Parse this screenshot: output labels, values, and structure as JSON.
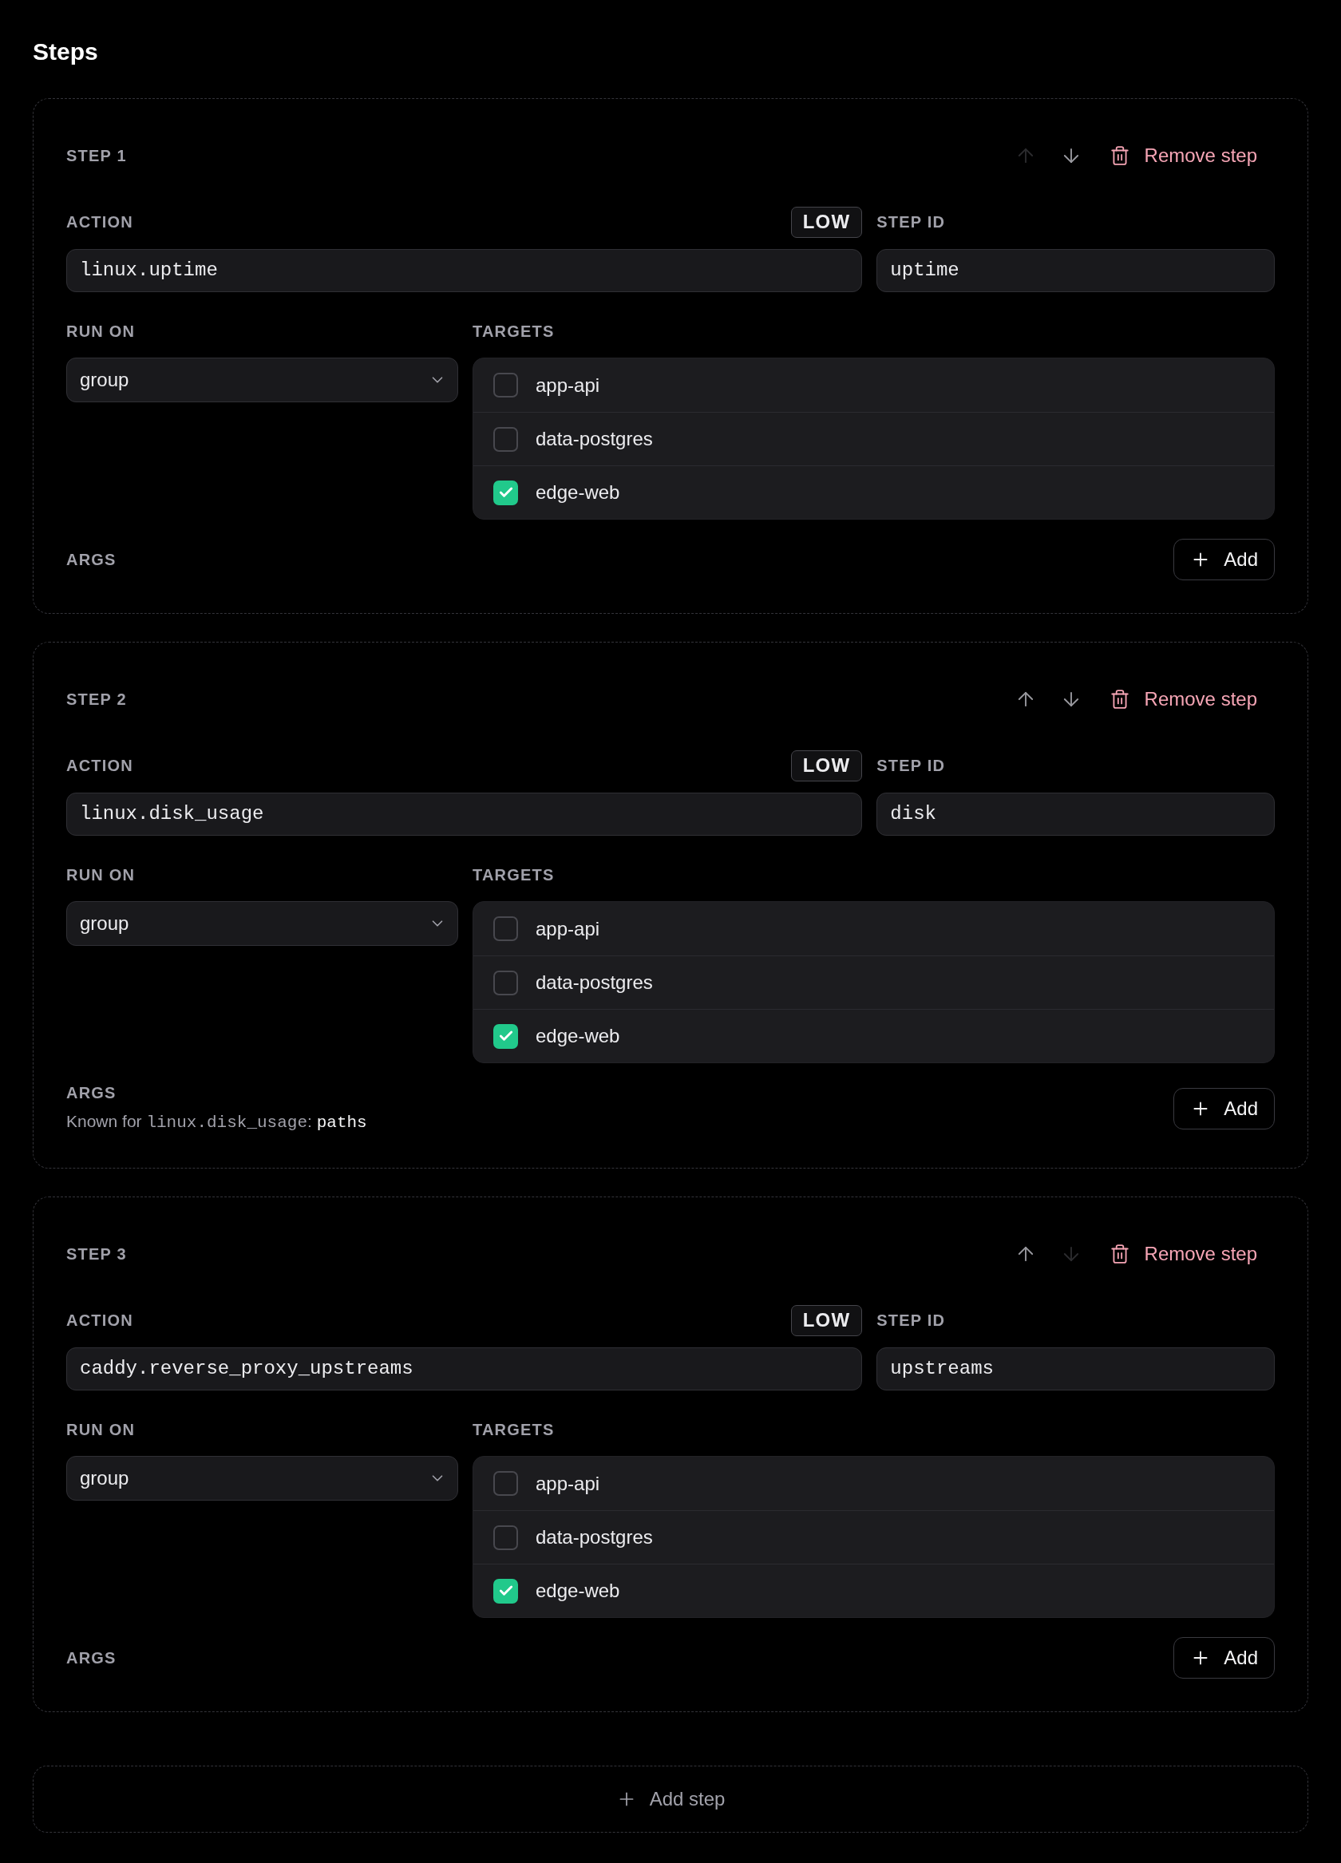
{
  "title": "Steps",
  "steps": [
    {
      "label": "STEP 1",
      "move_up": {
        "disabled": true
      },
      "move_down": {
        "disabled": false
      },
      "remove_label": "Remove step",
      "action": {
        "label": "ACTION",
        "value": "linux.uptime",
        "risk": "LOW"
      },
      "step_id": {
        "label": "STEP ID",
        "value": "uptime"
      },
      "run_on": {
        "label": "RUN ON",
        "value": "group"
      },
      "targets": {
        "label": "TARGETS",
        "items": [
          {
            "name": "app-api",
            "checked": false
          },
          {
            "name": "data-postgres",
            "checked": false
          },
          {
            "name": "edge-web",
            "checked": true
          }
        ]
      },
      "args": {
        "label": "ARGS",
        "add_label": "Add"
      }
    },
    {
      "label": "STEP 2",
      "move_up": {
        "disabled": false
      },
      "move_down": {
        "disabled": false
      },
      "remove_label": "Remove step",
      "action": {
        "label": "ACTION",
        "value": "linux.disk_usage",
        "risk": "LOW"
      },
      "step_id": {
        "label": "STEP ID",
        "value": "disk"
      },
      "run_on": {
        "label": "RUN ON",
        "value": "group"
      },
      "targets": {
        "label": "TARGETS",
        "items": [
          {
            "name": "app-api",
            "checked": false
          },
          {
            "name": "data-postgres",
            "checked": false
          },
          {
            "name": "edge-web",
            "checked": true
          }
        ]
      },
      "args": {
        "label": "ARGS",
        "hint": [
          {
            "kind": "plain",
            "text": "Known for "
          },
          {
            "kind": "code",
            "text": "linux.disk_usage"
          },
          {
            "kind": "plain",
            "text": ": "
          },
          {
            "kind": "key",
            "text": "paths"
          }
        ],
        "add_label": "Add"
      }
    },
    {
      "label": "STEP 3",
      "move_up": {
        "disabled": false
      },
      "move_down": {
        "disabled": true
      },
      "remove_label": "Remove step",
      "action": {
        "label": "ACTION",
        "value": "caddy.reverse_proxy_upstreams",
        "risk": "LOW"
      },
      "step_id": {
        "label": "STEP ID",
        "value": "upstreams"
      },
      "run_on": {
        "label": "RUN ON",
        "value": "group"
      },
      "targets": {
        "label": "TARGETS",
        "items": [
          {
            "name": "app-api",
            "checked": false
          },
          {
            "name": "data-postgres",
            "checked": false
          },
          {
            "name": "edge-web",
            "checked": true
          }
        ]
      },
      "args": {
        "label": "ARGS",
        "add_label": "Add"
      }
    }
  ],
  "add_step": "Add step"
}
